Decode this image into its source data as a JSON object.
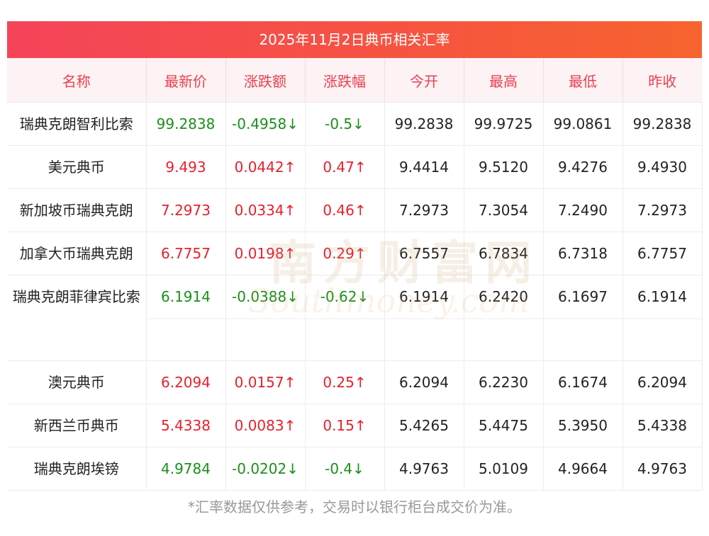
{
  "title": "2025年11月2日典币相关汇率",
  "headers": [
    "名称",
    "最新价",
    "涨跌额",
    "涨跌幅",
    "今开",
    "最高",
    "最低",
    "昨收"
  ],
  "rows": [
    {
      "name": "瑞典克朗智利比索",
      "latest": "99.2838",
      "change": "-0.4958↓",
      "pct": "-0.5↓",
      "open": "99.2838",
      "high": "99.9725",
      "low": "99.0861",
      "prev": "99.2838",
      "dir": "down"
    },
    {
      "name": "美元典币",
      "latest": "9.493",
      "change": "0.0442↑",
      "pct": "0.47↑",
      "open": "9.4414",
      "high": "9.5120",
      "low": "9.4276",
      "prev": "9.4930",
      "dir": "up"
    },
    {
      "name": "新加坡币瑞典克朗",
      "latest": "7.2973",
      "change": "0.0334↑",
      "pct": "0.46↑",
      "open": "7.2973",
      "high": "7.3054",
      "low": "7.2490",
      "prev": "7.2973",
      "dir": "up"
    },
    {
      "name": "加拿大币瑞典克朗",
      "latest": "6.7757",
      "change": "0.0198↑",
      "pct": "0.29↑",
      "open": "6.7557",
      "high": "6.7834",
      "low": "6.7318",
      "prev": "6.7757",
      "dir": "up"
    },
    {
      "name": "瑞典克朗菲律宾比索",
      "latest": "6.1914",
      "change": "-0.0388↓",
      "pct": "-0.62↓",
      "open": "6.1914",
      "high": "6.2420",
      "low": "6.1697",
      "prev": "6.1914",
      "dir": "down"
    },
    {
      "name": "澳元典币",
      "latest": "6.2094",
      "change": "0.0157↑",
      "pct": "0.25↑",
      "open": "6.2094",
      "high": "6.2230",
      "low": "6.1674",
      "prev": "6.2094",
      "dir": "up"
    },
    {
      "name": "新西兰币典币",
      "latest": "5.4338",
      "change": "0.0083↑",
      "pct": "0.15↑",
      "open": "5.4265",
      "high": "5.4475",
      "low": "5.3950",
      "prev": "5.4338",
      "dir": "up"
    },
    {
      "name": "瑞典克朗埃镑",
      "latest": "4.9784",
      "change": "-0.0202↓",
      "pct": "-0.4↓",
      "open": "4.9763",
      "high": "5.0109",
      "low": "4.9664",
      "prev": "4.9763",
      "dir": "down"
    }
  ],
  "watermark": {
    "cn": "南方财富网",
    "en": "Southmoney.com"
  },
  "footer": "*汇率数据仅供参考，交易时以银行柜台成交价为准。",
  "colors": {
    "up": "#e8202c",
    "down": "#1a8f1a",
    "header_text": "#e8404f",
    "title_bg": "#f5435a"
  }
}
